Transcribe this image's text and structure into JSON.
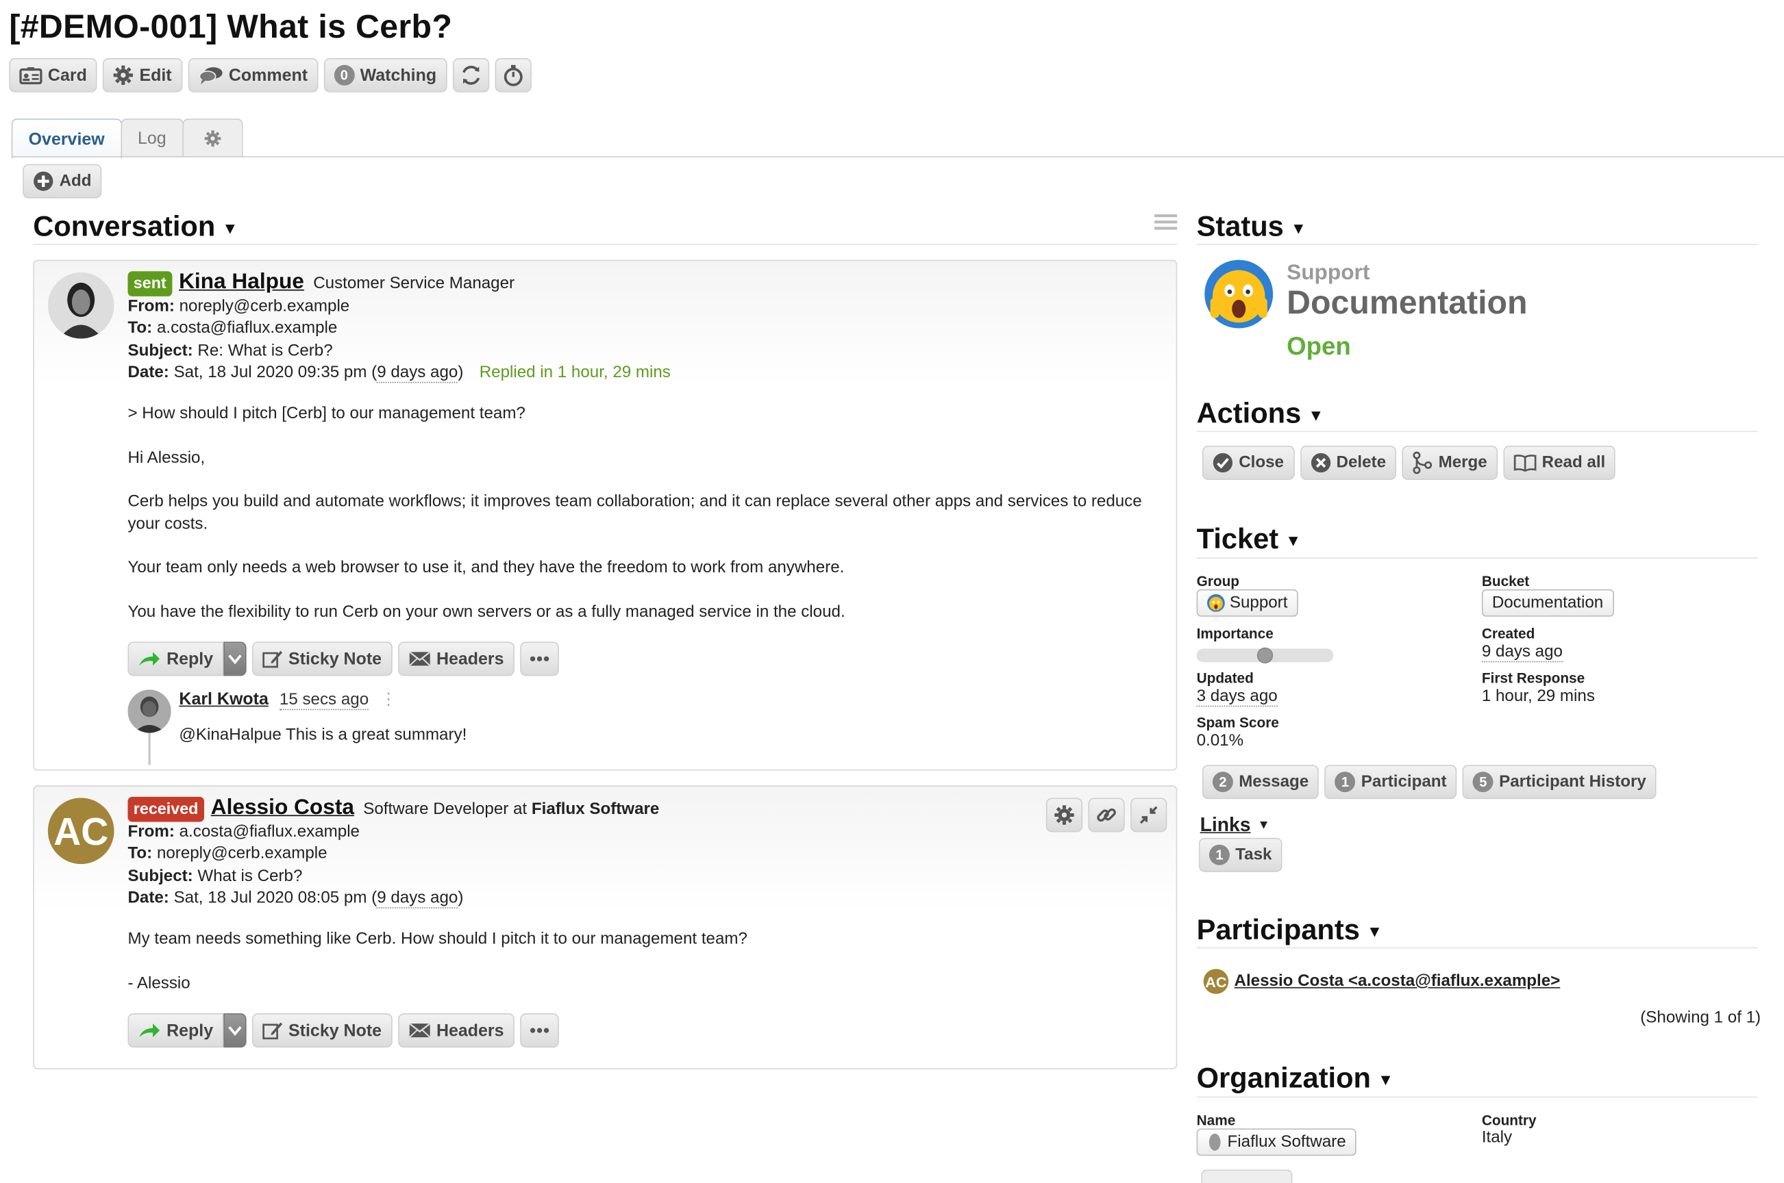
{
  "header": {
    "title": "[#DEMO-001] What is Cerb?",
    "toolbar": {
      "card": "Card",
      "edit": "Edit",
      "comment": "Comment",
      "watch_count": "0",
      "watching": "Watching"
    }
  },
  "tabs": [
    {
      "label": "Overview",
      "active": true
    },
    {
      "label": "Log",
      "active": false
    }
  ],
  "add_label": "Add",
  "conversation": {
    "title": "Conversation",
    "messages": [
      {
        "badge": "sent",
        "sender": "Kina Halpue",
        "sender_title": "Customer Service Manager",
        "from_label": "From:",
        "from": "noreply@cerb.example",
        "to_label": "To:",
        "to": "a.costa@fiaflux.example",
        "subject_label": "Subject:",
        "subject": "Re: What is Cerb?",
        "date_label": "Date:",
        "date": "Sat, 18 Jul 2020 09:35 pm (",
        "date_rel": "9 days ago",
        "date_close": ")",
        "replied": "Replied in 1 hour, 29 mins",
        "body": [
          "> How should I pitch [Cerb] to our management team?",
          "Hi Alessio,",
          "Cerb helps you build and automate workflows; it improves team collaboration; and it can replace several other apps and services to reduce your costs.",
          "Your team only needs a web browser to use it, and they have the freedom to work from anywhere.",
          "You have the flexibility to run Cerb on your own servers or as a fully managed service in the cloud."
        ],
        "actions": {
          "reply": "Reply",
          "sticky": "Sticky Note",
          "headers": "Headers"
        },
        "comment": {
          "author": "Karl Kwota",
          "time": "15 secs ago",
          "text": "@KinaHalpue This is a great summary!"
        }
      },
      {
        "badge": "received",
        "avatar_initials": "AC",
        "sender": "Alessio Costa",
        "sender_title": "Software Developer at",
        "sender_org": "Fiaflux Software",
        "from_label": "From:",
        "from": "a.costa@fiaflux.example",
        "to_label": "To:",
        "to": "noreply@cerb.example",
        "subject_label": "Subject:",
        "subject": "What is Cerb?",
        "date_label": "Date:",
        "date": "Sat, 18 Jul 2020 08:05 pm (",
        "date_rel": "9 days ago",
        "date_close": ")",
        "body": [
          "My team needs something like Cerb. How should I pitch it to our management team?",
          "- Alessio"
        ],
        "actions": {
          "reply": "Reply",
          "sticky": "Sticky Note",
          "headers": "Headers"
        }
      }
    ]
  },
  "status": {
    "title": "Status",
    "group": "Support",
    "bucket": "Documentation",
    "state": "Open"
  },
  "actions": {
    "title": "Actions",
    "close": "Close",
    "delete": "Delete",
    "merge": "Merge",
    "read_all": "Read all"
  },
  "ticket": {
    "title": "Ticket",
    "group_label": "Group",
    "group": "Support",
    "bucket_label": "Bucket",
    "bucket": "Documentation",
    "importance_label": "Importance",
    "importance": 0.5,
    "created_label": "Created",
    "created": "9 days ago",
    "updated_label": "Updated",
    "updated": "3 days ago",
    "first_response_label": "First Response",
    "first_response": "1 hour, 29 mins",
    "spam_label": "Spam Score",
    "spam": "0.01%",
    "counts": [
      {
        "n": "2",
        "label": "Message"
      },
      {
        "n": "1",
        "label": "Participant"
      },
      {
        "n": "5",
        "label": "Participant History"
      }
    ]
  },
  "links": {
    "title": "Links",
    "task_count": "1",
    "task": "Task"
  },
  "participants": {
    "title": "Participants",
    "avatar_initials": "AC",
    "item": "Alessio Costa <a.costa@fiaflux.example>",
    "showing": "(Showing 1 of 1)"
  },
  "organization": {
    "title": "Organization",
    "name_label": "Name",
    "name": "Fiaflux Software",
    "country_label": "Country",
    "country": "Italy"
  },
  "colors": {
    "sent": "#5f9c1e",
    "received": "#c73b2b",
    "open": "#5fae3a",
    "tab_active": "#2a5d8a"
  }
}
